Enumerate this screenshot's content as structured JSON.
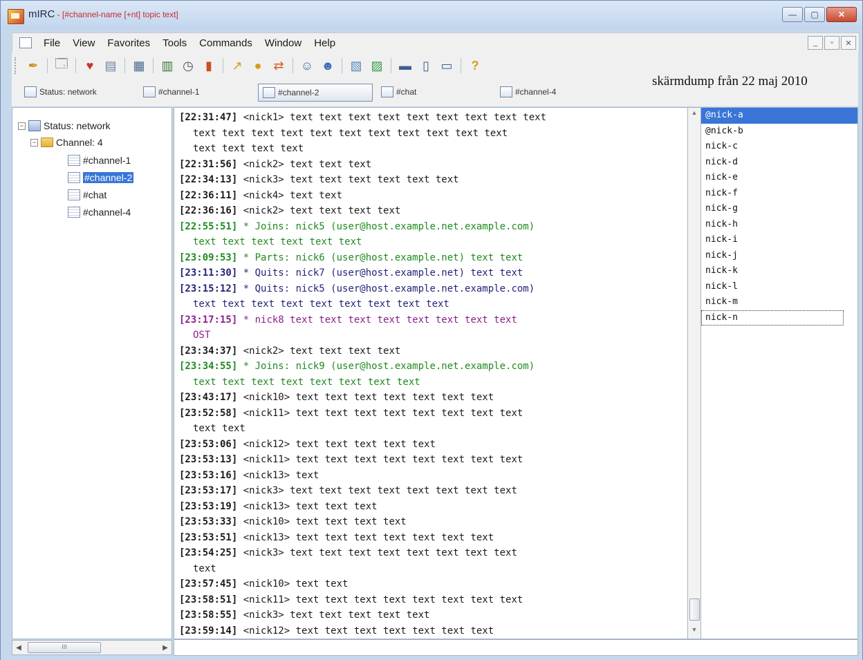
{
  "window": {
    "app_name": "mIRC",
    "title_rest": " - [#channel-name [+nt] topic text]",
    "buttons": {
      "minimize": "—",
      "maximize": "▢",
      "close": "✕"
    }
  },
  "menubar": {
    "items": [
      "File",
      "View",
      "Favorites",
      "Tools",
      "Commands",
      "Window",
      "Help"
    ],
    "mdi_buttons": [
      "_",
      "▫",
      "✕"
    ]
  },
  "toolbar": {
    "icons": [
      "connect-icon",
      "options-icon",
      "favorites-icon",
      "addressbook-icon",
      "scripts-editor-icon",
      "channel-list-icon",
      "timer-icon",
      "colors-icon",
      "send-file-icon",
      "chat-icon",
      "dcc-icon",
      "notify-list-icon",
      "url-list-icon",
      "log-icon",
      "received-icon",
      "tile-horizontal-icon",
      "tile-vertical-icon",
      "cascade-icon",
      "help-icon"
    ],
    "glyphs": [
      "✒",
      "🗔",
      "♥",
      "▤",
      "▦",
      "▥",
      "◷",
      "▮",
      "↗",
      "●",
      "⇄",
      "☺",
      "☻",
      "▧",
      "▨",
      "▬",
      "▯",
      "▭",
      "?"
    ]
  },
  "switchbar": {
    "buttons": [
      {
        "label": "Status: network"
      },
      {
        "label": "#channel-1"
      },
      {
        "label": "#channel-2"
      },
      {
        "label": "#chat"
      },
      {
        "label": "#channel-4"
      }
    ]
  },
  "screenshot_note": "skärmdump från 22 maj 2010",
  "tree": {
    "server": "Status: network",
    "folder": "Channel: 4",
    "channels": [
      "#channel-1",
      "#channel-2",
      "#chat",
      "#channel-4"
    ],
    "scroll_label": "III"
  },
  "chat": {
    "lines": [
      {
        "ts": "[22:31:47]",
        "text": " <nick1> text text text text text text text text text",
        "color": "#1a1a1a"
      },
      {
        "ts": "",
        "text": "text text text text text text text text text text text",
        "color": "#1a1a1a",
        "wrap": true
      },
      {
        "ts": "",
        "text": "text text text text",
        "color": "#1a1a1a",
        "wrap": true
      },
      {
        "ts": "[22:31:56]",
        "text": " <nick2> text text text",
        "color": "#1a1a1a"
      },
      {
        "ts": "[22:34:13]",
        "text": " <nick3> text text text text text text",
        "color": "#1a1a1a"
      },
      {
        "ts": "[22:36:11]",
        "text": " <nick4> text text",
        "color": "#1a1a1a"
      },
      {
        "ts": "[22:36:16]",
        "text": " <nick2> text text text text",
        "color": "#1a1a1a"
      },
      {
        "ts": "[22:55:51]",
        "text": " * Joins: nick5 (user@host.example.net.example.com)",
        "color": "#1f8a1f"
      },
      {
        "ts": "",
        "text": "text text text text text text",
        "color": "#1f8a1f",
        "wrap": true
      },
      {
        "ts": "[23:09:53]",
        "text": " * Parts: nick6 (user@host.example.net) text text",
        "color": "#1f8a1f"
      },
      {
        "ts": "[23:11:30]",
        "text": " * Quits: nick7 (user@host.example.net) text text",
        "color": "#23237a"
      },
      {
        "ts": "[23:15:12]",
        "text": " * Quits: nick5 (user@host.example.net.example.com)",
        "color": "#23237a"
      },
      {
        "ts": "",
        "text": "text text text text text text text text text",
        "color": "#23237a",
        "wrap": true
      },
      {
        "ts": "[23:17:15]",
        "text": " * nick8 text text text text text text text text",
        "color": "#8a1f8a"
      },
      {
        "ts": "",
        "text": "OST",
        "color": "#8a1f8a",
        "wrap": true
      },
      {
        "ts": "[23:34:37]",
        "text": " <nick2> text text text text",
        "color": "#1a1a1a"
      },
      {
        "ts": "[23:34:55]",
        "text": " * Joins: nick9 (user@host.example.net.example.com)",
        "color": "#1f8a1f"
      },
      {
        "ts": "",
        "text": "text text text text text text text text",
        "color": "#1f8a1f",
        "wrap": true
      },
      {
        "ts": "[23:43:17]",
        "text": " <nick10> text text text text text text text",
        "color": "#1a1a1a"
      },
      {
        "ts": "[23:52:58]",
        "text": " <nick11> text text text text text text text text",
        "color": "#1a1a1a"
      },
      {
        "ts": "",
        "text": "text text",
        "color": "#1a1a1a",
        "wrap": true
      },
      {
        "ts": "[23:53:06]",
        "text": " <nick12> text text text text text",
        "color": "#1a1a1a"
      },
      {
        "ts": "[23:53:13]",
        "text": " <nick11> text text text text text text text text",
        "color": "#1a1a1a"
      },
      {
        "ts": "[23:53:16]",
        "text": " <nick13> text",
        "color": "#1a1a1a"
      },
      {
        "ts": "[23:53:17]",
        "text": " <nick3> text text text text text text text text",
        "color": "#1a1a1a"
      },
      {
        "ts": "[23:53:19]",
        "text": " <nick13> text text text",
        "color": "#1a1a1a"
      },
      {
        "ts": "[23:53:33]",
        "text": " <nick10> text text text text",
        "color": "#1a1a1a"
      },
      {
        "ts": "[23:53:51]",
        "text": " <nick13> text text text text text text text",
        "color": "#1a1a1a"
      },
      {
        "ts": "[23:54:25]",
        "text": " <nick3> text text text text text text text text",
        "color": "#1a1a1a"
      },
      {
        "ts": "",
        "text": "text",
        "color": "#1a1a1a",
        "wrap": true
      },
      {
        "ts": "[23:57:45]",
        "text": " <nick10> text text",
        "color": "#1a1a1a"
      },
      {
        "ts": "[23:58:51]",
        "text": " <nick11> text text text text text text text text",
        "color": "#1a1a1a"
      },
      {
        "ts": "[23:58:55]",
        "text": " <nick3> text text text text text",
        "color": "#1a1a1a"
      },
      {
        "ts": "[23:59:14]",
        "text": " <nick12> text text text text text text text",
        "color": "#1a1a1a"
      }
    ]
  },
  "nicklist": {
    "nicks": [
      "@nick-a",
      "@nick-b",
      "nick-c",
      "nick-d",
      "nick-e",
      "nick-f",
      "nick-g",
      "nick-h",
      "nick-i",
      "nick-j",
      "nick-k",
      "nick-l",
      "nick-m",
      "nick-n"
    ],
    "selected_index": 0,
    "focus_index": 13
  }
}
